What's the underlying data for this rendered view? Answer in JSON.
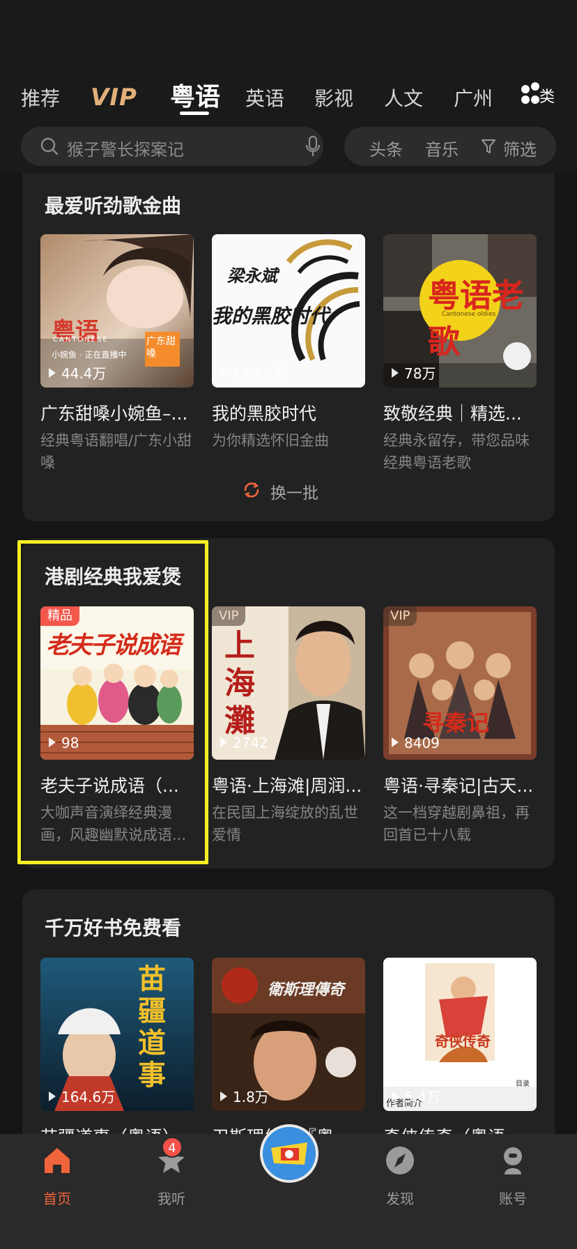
{
  "header": {
    "tabs": [
      {
        "label": "推荐"
      },
      {
        "label": "VIP"
      },
      {
        "label": "粤语"
      },
      {
        "label": "英语"
      },
      {
        "label": "影视"
      },
      {
        "label": "人文"
      },
      {
        "label": "广州"
      }
    ],
    "active_tab": "粤语",
    "search_placeholder": "猴子警长探案记",
    "filters": [
      "头条",
      "音乐",
      "筛选"
    ]
  },
  "sections": [
    {
      "title": "最爱听劲歌金曲",
      "items": [
        {
          "cover_text": "粤语",
          "cover_sub": "CANTONESE",
          "cover_badge": "广东甜嗓",
          "cover_live": "小婉鱼 · 正在直播中",
          "plays": "44.4万",
          "title": "广东甜嗓小婉鱼–...",
          "subtitle": "经典粤语翻唱/广东小甜嗓"
        },
        {
          "cover_text": "我的黑胶时代",
          "cover_author": "梁永斌",
          "plays": "178.6万",
          "title": "我的黑胶时代",
          "subtitle": "为你精选怀旧金曲"
        },
        {
          "cover_text": "粤语老歌",
          "cover_sub": "Cantonese oldies",
          "plays": "78万",
          "title": "致敬经典｜精选...",
          "subtitle": "经典永留存，带您品味经典粤语老歌"
        }
      ],
      "refresh_label": "换一批"
    },
    {
      "title": "港剧经典我爱煲",
      "items": [
        {
          "badge": "精品",
          "cover_text": "老夫子说成语",
          "plays": "98",
          "title": "老夫子说成语（...",
          "subtitle": "大咖声音演绎经典漫画，风趣幽默说成语..."
        },
        {
          "badge": "VIP",
          "cover_text": "上海灘",
          "plays": "2742",
          "title": "粤语·上海滩|周润...",
          "subtitle": "在民国上海绽放的乱世爱情"
        },
        {
          "badge": "VIP",
          "cover_text": "寻秦记",
          "plays": "8409",
          "title": "粤语·寻秦记|古天...",
          "subtitle": "这一档穿越剧鼻祖，再回首已十八载"
        }
      ]
    },
    {
      "title": "千万好书免费看",
      "items": [
        {
          "cover_text": "苗疆道事",
          "plays": "164.6万",
          "title": "苗疆道事（粤语）"
        },
        {
          "cover_text": "衛斯理傳奇",
          "plays": "1.8万",
          "title": "卫斯理传说『粤"
        },
        {
          "cover_text": "奇侠传奇",
          "cover_label": "作者简介",
          "cover_menu": "目录",
          "plays": "5.4万",
          "title": "奇侠传奇（粤语"
        }
      ]
    }
  ],
  "bottom_nav": [
    {
      "label": "首页",
      "icon": "home-icon",
      "active": true
    },
    {
      "label": "我听",
      "icon": "star-icon",
      "badge": "4"
    },
    {
      "label": "",
      "icon": "center-play-icon"
    },
    {
      "label": "发现",
      "icon": "compass-icon"
    },
    {
      "label": "账号",
      "icon": "account-icon"
    }
  ],
  "colors": {
    "accent": "#f0643c",
    "highlight": "#f7ef23",
    "badge_red": "#f4574b"
  }
}
